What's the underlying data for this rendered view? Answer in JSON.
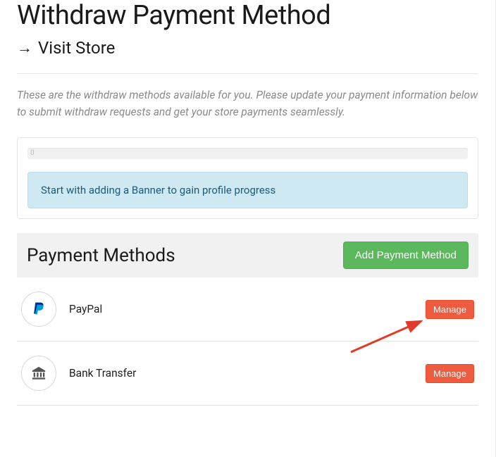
{
  "header": {
    "title": "Withdraw Payment Method",
    "visit_store_label": "Visit Store"
  },
  "description": "These are the withdraw methods available for you. Please update your payment information below to submit withdraw requests and get your store payments seamlessly.",
  "progress": {
    "value_text": "0",
    "tip": "Start with adding a Banner to gain profile progress"
  },
  "section": {
    "title": "Payment Methods",
    "add_button": "Add Payment Method"
  },
  "methods": [
    {
      "icon": "paypal",
      "name": "PayPal",
      "manage_label": "Manage"
    },
    {
      "icon": "bank",
      "name": "Bank Transfer",
      "manage_label": "Manage"
    }
  ],
  "colors": {
    "add_button_bg": "#5cb85c",
    "manage_button_bg": "#ef5b3f",
    "alert_bg": "#cfe9f3"
  }
}
